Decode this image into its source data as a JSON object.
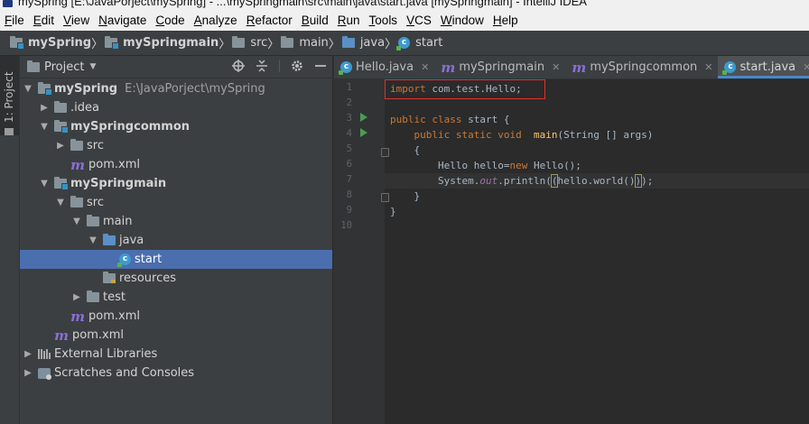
{
  "window": {
    "title": "mySpring [E:\\JavaPorject\\mySpring] - ...\\mySpringmain\\src\\main\\java\\start.java [mySpringmain] - IntelliJ IDEA"
  },
  "menu": [
    "File",
    "Edit",
    "View",
    "Navigate",
    "Code",
    "Analyze",
    "Refactor",
    "Build",
    "Run",
    "Tools",
    "VCS",
    "Window",
    "Help"
  ],
  "breadcrumb": [
    "mySpring",
    "mySpringmain",
    "src",
    "main",
    "java",
    "start"
  ],
  "toolstrip": {
    "project_tab": "1: Project"
  },
  "project_panel": {
    "title": "Project",
    "tree": [
      {
        "label": "mySpring",
        "path": "E:\\JavaPorject\\mySpring"
      },
      {
        "label": ".idea"
      },
      {
        "label": "mySpringcommon"
      },
      {
        "label": "src"
      },
      {
        "label": "pom.xml"
      },
      {
        "label": "mySpringmain"
      },
      {
        "label": "src"
      },
      {
        "label": "main"
      },
      {
        "label": "java"
      },
      {
        "label": "start"
      },
      {
        "label": "resources"
      },
      {
        "label": "test"
      },
      {
        "label": "pom.xml"
      },
      {
        "label": "pom.xml"
      },
      {
        "label": "External Libraries"
      },
      {
        "label": "Scratches and Consoles"
      }
    ]
  },
  "editor": {
    "tabs": [
      {
        "label": "Hello.java",
        "icon": "class-icon"
      },
      {
        "label": "mySpringmain",
        "icon": "maven-icon"
      },
      {
        "label": "mySpringcommon",
        "icon": "maven-icon"
      },
      {
        "label": "start.java",
        "icon": "class-icon",
        "active": true
      }
    ],
    "line_numbers": [
      "1",
      "2",
      "3",
      "4",
      "5",
      "6",
      "7",
      "8",
      "9",
      "10"
    ],
    "code": {
      "l1_kw": "import",
      "l1_rest": " com.test.Hello;",
      "l3_kw": "public class",
      "l3_rest": " start {",
      "l4_indent": "    ",
      "l4_kw": "public static void",
      "l4_sp": "  ",
      "l4_fn": "main",
      "l4_rest": "(String [] args)",
      "l5": "    {",
      "l6_a": "        Hello hello=",
      "l6_kw": "new",
      "l6_b": " Hello();",
      "l7_a": "        System.",
      "l7_fld": "out",
      "l7_b": ".println(",
      "l7_br1": "(",
      "l7_c": "hello.world()",
      "l7_br2": ")",
      "l7_d": ");",
      "l8": "    }",
      "l9": "}"
    }
  },
  "colors": {
    "keyword": "#cc7832",
    "method": "#ffc66d",
    "field": "#9876aa",
    "selection": "#4b6eaf",
    "annotation_box": "#e03030"
  }
}
